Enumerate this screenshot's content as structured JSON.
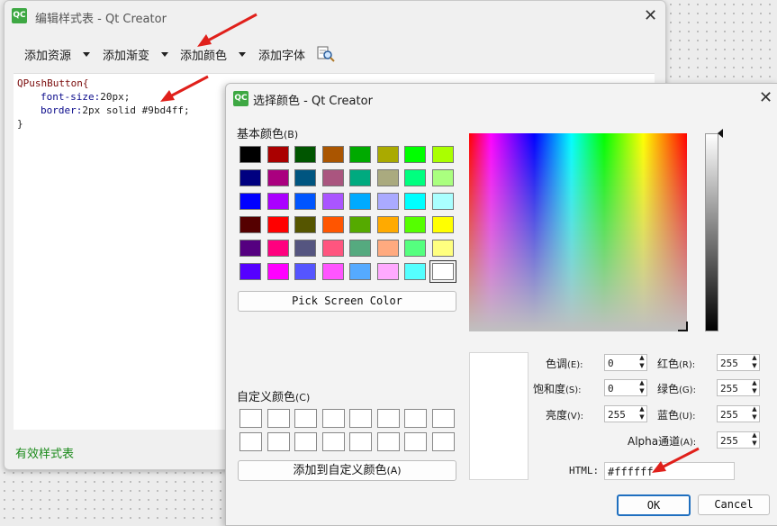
{
  "stylesheet_window": {
    "title": "编辑样式表 - Qt Creator",
    "toolbar": [
      "添加资源",
      "添加渐变",
      "添加颜色",
      "添加字体"
    ],
    "code_lines": [
      {
        "cls": "QPushButton{"
      },
      {
        "prop": "font-size:",
        "val": "20px;"
      },
      {
        "prop": "border:",
        "val": "2px solid #9bd4ff;"
      },
      {
        "cls": "}"
      }
    ],
    "status": "有效样式表"
  },
  "color_dialog": {
    "title": "选择颜色 - Qt Creator",
    "basic_colors_label": "基本颜色",
    "basic_colors_shortcut": "(B)",
    "basic_colors": [
      "#000000",
      "#aa0000",
      "#005500",
      "#aa5500",
      "#00aa00",
      "#aaaa00",
      "#00ff00",
      "#aaff00",
      "#000080",
      "#aa007f",
      "#005580",
      "#aa557f",
      "#00aa7f",
      "#aaaa7f",
      "#00ff7f",
      "#aaff7f",
      "#0000ff",
      "#aa00ff",
      "#0055ff",
      "#aa55ff",
      "#00aaff",
      "#aaaaff",
      "#00ffff",
      "#aaffff",
      "#550000",
      "#ff0000",
      "#555500",
      "#ff5500",
      "#55aa00",
      "#ffaa00",
      "#55ff00",
      "#ffff00",
      "#550080",
      "#ff007f",
      "#555580",
      "#ff557f",
      "#55aa7f",
      "#ffaa7f",
      "#55ff7f",
      "#ffff7f",
      "#5500ff",
      "#ff00ff",
      "#5555ff",
      "#ff55ff",
      "#55aaff",
      "#ffaaff",
      "#55ffff",
      "#ffffff"
    ],
    "pick_screen_color": "Pick Screen Color",
    "custom_colors_label": "自定义颜色",
    "custom_colors_shortcut": "(C)",
    "add_custom_button": "添加到自定义颜色",
    "add_custom_shortcut": "(A)",
    "fields": {
      "hue": {
        "label": "色调",
        "shortcut": "(E):",
        "value": "0"
      },
      "sat": {
        "label": "饱和度",
        "shortcut": "(S):",
        "value": "0"
      },
      "val": {
        "label": "亮度",
        "shortcut": "(V):",
        "value": "255"
      },
      "red": {
        "label": "红色",
        "shortcut": "(R):",
        "value": "255"
      },
      "green": {
        "label": "绿色",
        "shortcut": "(G):",
        "value": "255"
      },
      "blue": {
        "label": "蓝色",
        "shortcut": "(U):",
        "value": "255"
      },
      "alpha": {
        "label": "Alpha通道",
        "shortcut": "(A):",
        "value": "255"
      }
    },
    "html_label": "HTML:",
    "html_value": "#ffffff",
    "ok": "OK",
    "cancel": "Cancel"
  }
}
